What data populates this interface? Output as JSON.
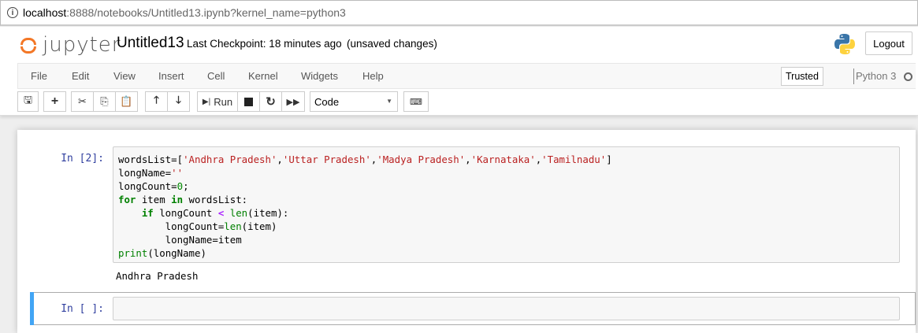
{
  "browser": {
    "url_host": "localhost",
    "url_rest": ":8888/notebooks/Untitled13.ipynb?kernel_name=python3"
  },
  "header": {
    "logo_text": "jupyter",
    "notebook_name": "Untitled13",
    "checkpoint": "Last Checkpoint: 18 minutes ago",
    "unsaved": "(unsaved changes)",
    "logout": "Logout"
  },
  "menu": {
    "items": [
      "File",
      "Edit",
      "View",
      "Insert",
      "Cell",
      "Kernel",
      "Widgets",
      "Help"
    ],
    "trusted": "Trusted",
    "kernel": "Python 3"
  },
  "toolbar": {
    "run_label": "Run",
    "cell_type": "Code"
  },
  "cells": [
    {
      "prompt": "In [2]:",
      "code": [
        [
          [
            "wordsList=[",
            ""
          ],
          [
            "'Andhra Pradesh'",
            "str"
          ],
          [
            ",",
            ""
          ],
          [
            "'Uttar Pradesh'",
            "str"
          ],
          [
            ",",
            ""
          ],
          [
            "'Madya Pradesh'",
            "str"
          ],
          [
            ",",
            ""
          ],
          [
            "'Karnataka'",
            "str"
          ],
          [
            ",",
            ""
          ],
          [
            "'Tamilnadu'",
            "str"
          ],
          [
            "]",
            ""
          ]
        ],
        [
          [
            "longName=",
            ""
          ],
          [
            "''",
            "str"
          ]
        ],
        [
          [
            "longCount=",
            ""
          ],
          [
            "0",
            "num"
          ],
          [
            ";",
            ""
          ]
        ],
        [
          [
            "for",
            "kw"
          ],
          [
            " item ",
            ""
          ],
          [
            "in",
            "kw"
          ],
          [
            " wordsList:",
            ""
          ]
        ],
        [
          [
            "    ",
            ""
          ],
          [
            "if",
            "kw"
          ],
          [
            " longCount ",
            ""
          ],
          [
            "<",
            "op"
          ],
          [
            " ",
            ""
          ],
          [
            "len",
            "bi"
          ],
          [
            "(item):",
            ""
          ]
        ],
        [
          [
            "        longCount=",
            ""
          ],
          [
            "len",
            "bi"
          ],
          [
            "(item)",
            ""
          ]
        ],
        [
          [
            "        longName=item",
            ""
          ]
        ],
        [
          [
            "print",
            "bi"
          ],
          [
            "(longName)",
            ""
          ]
        ]
      ],
      "output": "Andhra Pradesh"
    },
    {
      "prompt": "In [ ]:"
    }
  ]
}
